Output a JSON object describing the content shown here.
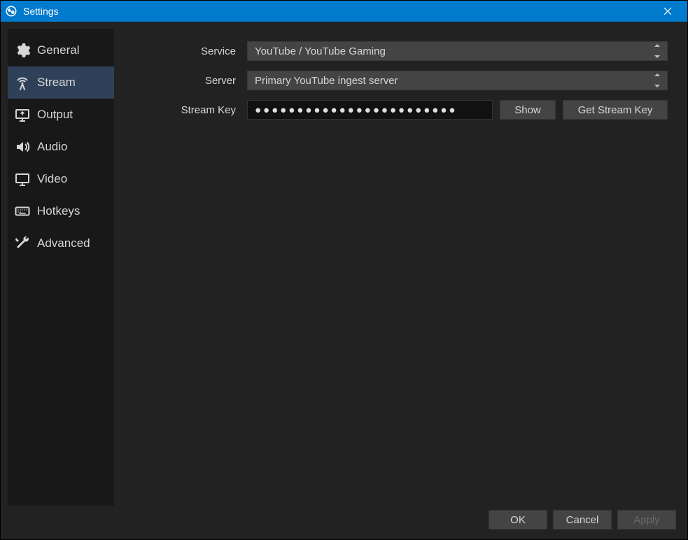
{
  "window": {
    "title": "Settings"
  },
  "sidebar": {
    "items": [
      {
        "label": "General"
      },
      {
        "label": "Stream"
      },
      {
        "label": "Output"
      },
      {
        "label": "Audio"
      },
      {
        "label": "Video"
      },
      {
        "label": "Hotkeys"
      },
      {
        "label": "Advanced"
      }
    ],
    "activeIndex": 1
  },
  "form": {
    "service_label": "Service",
    "service_value": "YouTube / YouTube Gaming",
    "server_label": "Server",
    "server_value": "Primary YouTube ingest server",
    "streamkey_label": "Stream Key",
    "streamkey_masked": "●●●●●●●●●●●●●●●●●●●●●●●●",
    "show_label": "Show",
    "get_key_label": "Get Stream Key"
  },
  "footer": {
    "ok": "OK",
    "cancel": "Cancel",
    "apply": "Apply"
  }
}
